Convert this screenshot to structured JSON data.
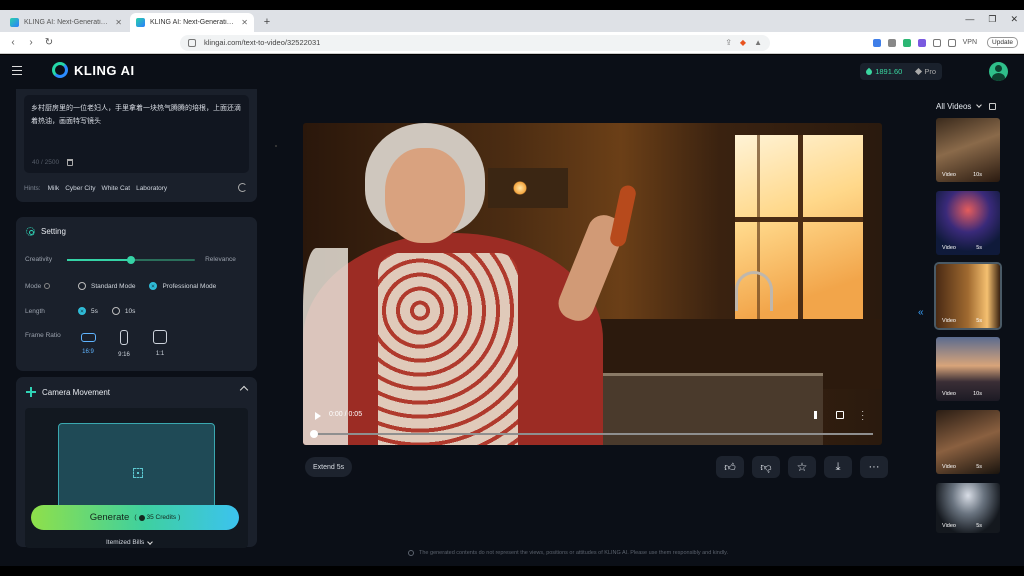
{
  "browser": {
    "tabs": [
      {
        "title": "KLING AI: Next-Generation AI Crea",
        "active": false
      },
      {
        "title": "KLING AI: Next-Generation AI Cr",
        "active": true
      }
    ],
    "new_tab_label": "+",
    "window_controls": [
      "—",
      "❐",
      "✕"
    ],
    "url": "klingai.com/text-to-video/32522031",
    "vpn_label": "VPN",
    "update_label": "Update"
  },
  "nav": {
    "logo_text": "KLING AI",
    "credits": "1891.60",
    "plan": "Pro"
  },
  "prompt": {
    "text": "乡村厨房里的一位老妇人，手里拿着一块热气腾腾的培根，上面还滴着热油，画面特写镜头",
    "counter": "40 / 2500",
    "hints_label": "Hints:",
    "hints": [
      "Milk",
      "Cyber City",
      "White Cat",
      "Laboratory"
    ]
  },
  "setting": {
    "title": "Setting",
    "creativity_label": "Creativity",
    "relevance_label": "Relevance",
    "slider_value": 0.5,
    "mode_label": "Mode",
    "mode_options": [
      "Standard Mode",
      "Professional Mode"
    ],
    "mode_selected": "Professional Mode",
    "length_label": "Length",
    "length_options": [
      "5s",
      "10s"
    ],
    "length_selected": "5s",
    "ratio_label": "Frame Ratio",
    "ratios": [
      "16:9",
      "9:16",
      "1:1"
    ],
    "ratio_selected": "16:9"
  },
  "camera": {
    "title": "Camera Movement"
  },
  "generate": {
    "label": "Generate",
    "credits": "35 Credits",
    "itemized_label": "Itemized Bills"
  },
  "player": {
    "timecode": "0:00 / 0:05",
    "progress": 0
  },
  "toolbar": {
    "extend_label": "Extend 5s"
  },
  "footer": {
    "note": "The generated contents do not represent the views, positions or attitudes of KLING AI. Please use them responsibly and kindly."
  },
  "library": {
    "title": "All Videos",
    "items": [
      {
        "label": "Video",
        "duration": "10s"
      },
      {
        "label": "Video",
        "duration": "5s"
      },
      {
        "label": "Video",
        "duration": "5s"
      },
      {
        "label": "Video",
        "duration": "10s"
      },
      {
        "label": "Video",
        "duration": "5s"
      },
      {
        "label": "Video",
        "duration": "5s"
      }
    ],
    "selected_index": 2
  },
  "colors": {
    "accent": "#35d3a6",
    "selected_ratio": "#5fb4ff",
    "app_bg": "#0b0f17",
    "panel_bg": "#1a202b"
  }
}
